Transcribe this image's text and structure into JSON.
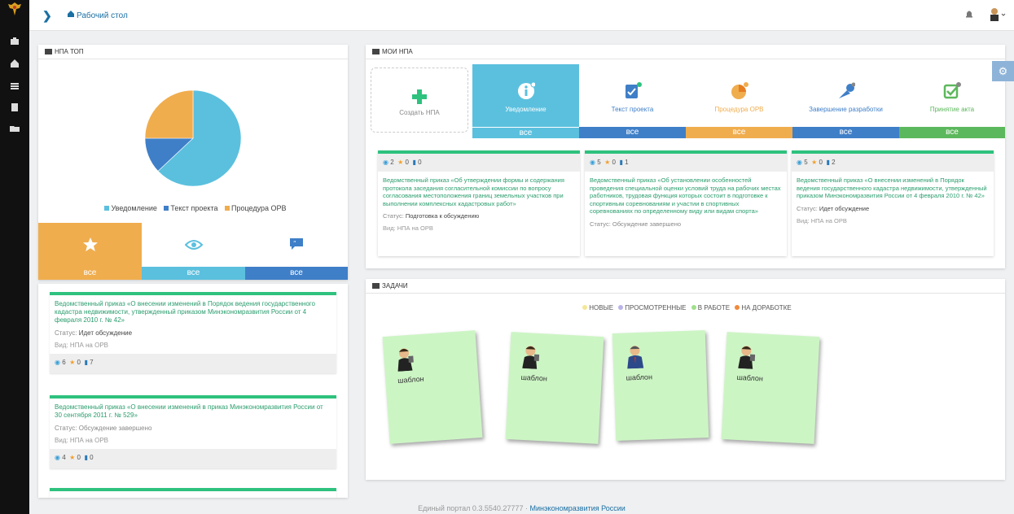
{
  "nav": {
    "breadcrumb": "Рабочий стол",
    "icons": [
      "emblem-icon",
      "briefcase-icon",
      "home-icon",
      "list-icon",
      "file-icon",
      "folder-icon"
    ]
  },
  "npa_top": {
    "title": "НПА ТОП",
    "legend": [
      "Уведомление",
      "Текст проекта",
      "Процедура ОРВ"
    ],
    "colors": {
      "notice": "#5bc0de",
      "text": "#3f7fc8",
      "orv": "#f0ad4e"
    },
    "tabs": [
      "все",
      "все",
      "все"
    ]
  },
  "chart_data": {
    "type": "pie",
    "categories": [
      "Уведомление",
      "Текст проекта",
      "Процедура ОРВ"
    ],
    "values": [
      63,
      12,
      25
    ]
  },
  "npa_list": [
    {
      "title": "Ведомственный приказ «О внесении изменений в Порядок ведения государственного кадастра недвижимости, утвержденный приказом Минэкономразвития России от 4 февраля 2010 г. № 42»",
      "status_label": "Статус:",
      "status": "Идет обсуждение",
      "kind": "Вид: НПА на ОРВ",
      "views": "6",
      "stars": "0",
      "comments": "7"
    },
    {
      "title": "Ведомственный приказ «О внесении изменений в приказ Минэкономразвития России от 30 сентября 2011 г. № 529»",
      "status_label": "Статус:",
      "status": "Обсуждение завершено",
      "kind": "Вид: НПА на ОРВ",
      "views": "4",
      "stars": "0",
      "comments": "0"
    }
  ],
  "moi_npa": {
    "title": "МОИ НПА",
    "categories": [
      {
        "label": "Создать НПА",
        "vse": ""
      },
      {
        "label": "Уведомление",
        "vse": "все"
      },
      {
        "label": "Текст проекта",
        "vse": "все"
      },
      {
        "label": "Процедура ОРВ",
        "vse": "все"
      },
      {
        "label": "Завершение разработки",
        "vse": "все"
      },
      {
        "label": "Принятие акта",
        "vse": "все"
      }
    ],
    "cards": [
      {
        "views": "2",
        "stars": "0",
        "comments": "0",
        "title": "Ведомственный приказ «Об утверждении формы и содержания протокола заседания согласительной комиссии по вопросу согласования местоположения границ земельных участков при выполнении комплексных кадастровых работ»",
        "status_label": "Статус:",
        "status": "Подготовка к обсуждению",
        "kind": "Вид: НПА на ОРВ"
      },
      {
        "views": "5",
        "stars": "0",
        "comments": "1",
        "title": "Ведомственный приказ «Об установлении особенностей проведения специальной оценки условий труда на рабочих местах работников, трудовая функция которых состоит в подготовке к спортивным соревнованиям и участии в спортивных соревнованиях по определенному виду или видам спорта»",
        "status_label": "Статус:",
        "status": "Обсуждение завершено",
        "kind": ""
      },
      {
        "views": "5",
        "stars": "0",
        "comments": "2",
        "title": "Ведомственный приказ «О внесении изменений в Порядок ведения государственного кадастра недвижимости, утвержденный приказом Минэкономразвития России от 4 февраля 2010 г. № 42»",
        "status_label": "Статус:",
        "status": "Идет обсуждение",
        "kind": "Вид: НПА на ОРВ"
      }
    ]
  },
  "tasks": {
    "title": "ЗАДАЧИ",
    "legend": [
      "НОВЫЕ",
      "ПРОСМОТРЕННЫЕ",
      "В РАБОТЕ",
      "НА ДОРАБОТКЕ"
    ],
    "legend_colors": [
      "#f5e79a",
      "#b9b3e8",
      "#9fe08a",
      "#f08a3c"
    ],
    "notes": [
      "шаблон",
      "шаблон",
      "шаблон",
      "шаблон"
    ]
  },
  "footer": {
    "text": "Единый портал 0.3.5540.27777 ·",
    "link": "Минэкономразвития России"
  }
}
